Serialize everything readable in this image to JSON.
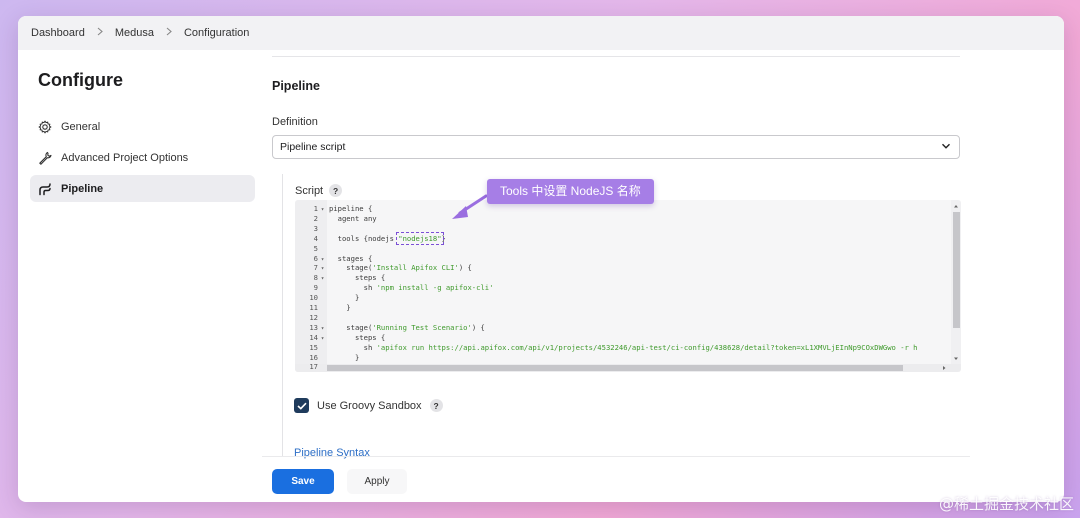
{
  "breadcrumb": {
    "items": [
      "Dashboard",
      "Medusa",
      "Configuration"
    ]
  },
  "sidebar": {
    "title": "Configure",
    "items": [
      {
        "label": "General",
        "icon": "gear-icon",
        "active": false
      },
      {
        "label": "Advanced Project Options",
        "icon": "wrench-icon",
        "active": false
      },
      {
        "label": "Pipeline",
        "icon": "pipeline-icon",
        "active": true
      }
    ]
  },
  "main": {
    "section_title": "Pipeline",
    "definition_label": "Definition",
    "definition_value": "Pipeline script",
    "script_label": "Script",
    "help_glyph": "?",
    "groovy_label": "Use Groovy Sandbox",
    "syntax_link": "Pipeline Syntax"
  },
  "editor": {
    "lines": [
      {
        "n": "1",
        "fold": true,
        "code": "pipeline {"
      },
      {
        "n": "2",
        "fold": false,
        "code": "  agent any"
      },
      {
        "n": "3",
        "fold": false,
        "code": ""
      },
      {
        "n": "4",
        "fold": false,
        "code": "  tools {nodejs ",
        "str": "\"nodejs18\"",
        "tail": "}"
      },
      {
        "n": "5",
        "fold": false,
        "code": ""
      },
      {
        "n": "6",
        "fold": true,
        "code": "  stages {"
      },
      {
        "n": "7",
        "fold": true,
        "code": "    stage(",
        "str": "'Install Apifox CLI'",
        "tail": ") {"
      },
      {
        "n": "8",
        "fold": true,
        "code": "      steps {"
      },
      {
        "n": "9",
        "fold": false,
        "code": "        sh ",
        "str": "'npm install -g apifox-cli'",
        "tail": ""
      },
      {
        "n": "10",
        "fold": false,
        "code": "      }"
      },
      {
        "n": "11",
        "fold": false,
        "code": "    }"
      },
      {
        "n": "12",
        "fold": false,
        "code": ""
      },
      {
        "n": "13",
        "fold": true,
        "code": "    stage(",
        "str": "'Running Test Scenario'",
        "tail": ") {"
      },
      {
        "n": "14",
        "fold": true,
        "code": "      steps {"
      },
      {
        "n": "15",
        "fold": false,
        "code": "        sh ",
        "str": "'apifox run https://api.apifox.com/api/v1/projects/4532246/api-test/ci-config/438628/detail?token=xL1XMVLjEInNp9COxDWGwo -r h",
        "tail": ""
      },
      {
        "n": "16",
        "fold": false,
        "code": "      }"
      },
      {
        "n": "17",
        "fold": false,
        "code": ""
      }
    ]
  },
  "callout": {
    "text": "Tools 中设置 NodeJS 名称"
  },
  "buttons": {
    "save": "Save",
    "apply": "Apply"
  },
  "watermark": "@稀土掘金技术社区",
  "colors": {
    "primary": "#1a6fe0",
    "callout": "#a67ee6",
    "string": "#3f9a2c",
    "checkbox": "#1f3b5c"
  }
}
